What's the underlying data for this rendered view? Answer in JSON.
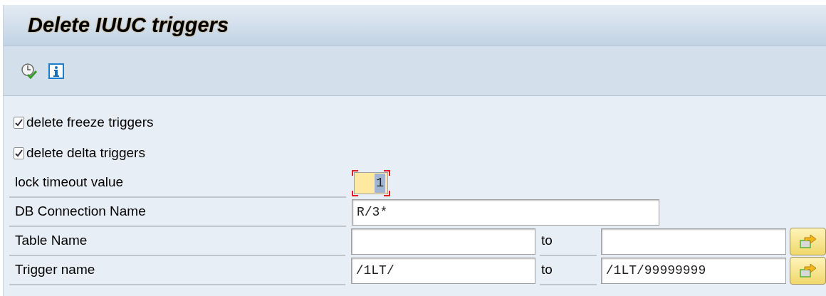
{
  "window": {
    "title": "Delete IUUC triggers"
  },
  "toolbar": [
    {
      "kind": "execute"
    },
    {
      "kind": "info"
    }
  ],
  "checkboxes": [
    {
      "label": "delete freeze triggers",
      "checked": true
    },
    {
      "label": "delete delta triggers",
      "checked": true
    }
  ],
  "fields": [
    {
      "kind": "short",
      "label": "lock timeout value",
      "value": "1",
      "focused": true
    },
    {
      "kind": "long",
      "label": "DB Connection Name",
      "value": "R/3*"
    },
    {
      "kind": "range",
      "label": "Table Name",
      "to_label": "to"
    },
    {
      "kind": "range",
      "label": "Trigger name",
      "low": "/1LT/",
      "to_label": "to",
      "high": "/1LT/99999999"
    }
  ]
}
